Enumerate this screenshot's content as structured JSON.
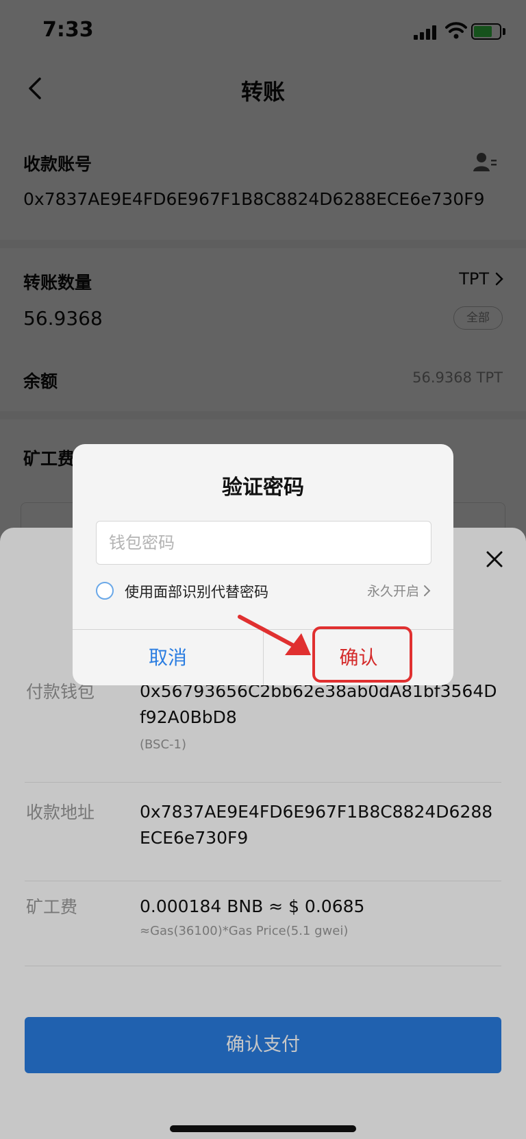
{
  "status_bar": {
    "time": "7:33"
  },
  "nav": {
    "title": "转账"
  },
  "form": {
    "recipient_label": "收款账号",
    "recipient_value": "0x7837AE9E4FD6E967F1B8C8824D6288ECE6e730F9",
    "amount_label": "转账数量",
    "amount_value": "56.9368",
    "token": "TPT",
    "all_label": "全部",
    "balance_label": "余额",
    "balance_value": "56.9368 TPT",
    "fee_label": "矿工费"
  },
  "sheet": {
    "rows": [
      {
        "label": "付款钱包",
        "value": "0x56793656C2bb62e38ab0dA81bf3564Df92A0BbD8",
        "sub": "(BSC-1)"
      },
      {
        "label": "收款地址",
        "value": "0x7837AE9E4FD6E967F1B8C8824D6288ECE6e730F9",
        "sub": ""
      },
      {
        "label": "矿工费",
        "value": "0.000184 BNB ≈ $ 0.0685",
        "sub": "≈Gas(36100)*Gas Price(5.1 gwei)"
      }
    ],
    "pay_button": "确认支付"
  },
  "dialog": {
    "title": "验证密码",
    "password_placeholder": "钱包密码",
    "faceid_label": "使用面部识别代替密码",
    "faceid_option": "永久开启",
    "cancel": "取消",
    "confirm": "确认"
  },
  "colors": {
    "accent": "#2a7de1",
    "highlight": "#e03030"
  }
}
